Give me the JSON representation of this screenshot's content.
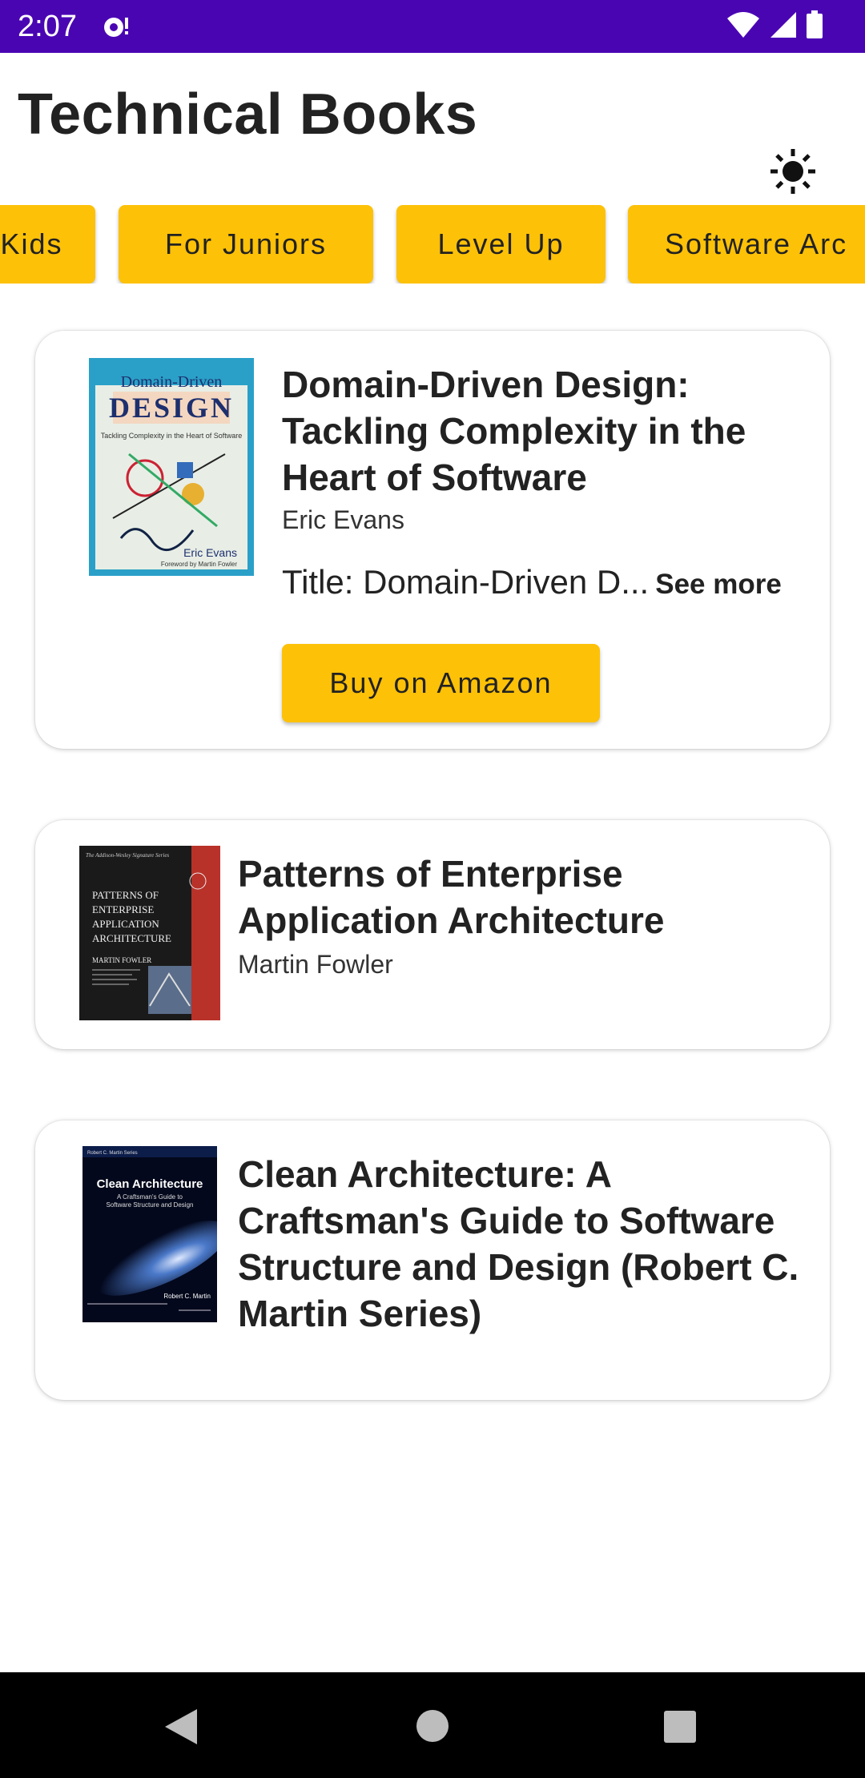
{
  "status_bar": {
    "time": "2:07"
  },
  "app_bar": {
    "title": "Technical Books",
    "theme_icon": "sun-icon"
  },
  "categories": [
    "Kids",
    "For Juniors",
    "Level Up",
    "Software Arc"
  ],
  "books": [
    {
      "title": "Domain-Driven Design: Tackling Complexity in the Heart of Software",
      "author": "Eric Evans",
      "description": "Title: Domain-Driven D...",
      "see_more": "See more",
      "buy_label": "Buy on Amazon",
      "cover": {
        "top": "Domain-Driven",
        "big": "DESIGN",
        "sub": "Tackling Complexity in the Heart of Software",
        "author": "Eric Evans",
        "foreword": "Foreword by Martin Fowler"
      }
    },
    {
      "title": "Patterns of Enterprise Application Architecture",
      "author": "Martin Fowler",
      "cover": {
        "series": "The Addison-Wesley Signature Series",
        "l1": "PATTERNS OF",
        "l2": "ENTERPRISE",
        "l3": "APPLICATION",
        "l4": "ARCHITECTURE",
        "author": "MARTIN FOWLER"
      }
    },
    {
      "title": "Clean Architecture: A Craftsman's Guide to Software Structure and Design (Robert C. Martin Series)",
      "author": "",
      "cover": {
        "series": "Robert C. Martin Series",
        "title": "Clean Architecture",
        "sub1": "A Craftsman's Guide to",
        "sub2": "Software Structure and Design",
        "author": "Robert C. Martin"
      }
    }
  ],
  "colors": {
    "accent": "#fdc108",
    "status_bar": "#4a05b3"
  }
}
